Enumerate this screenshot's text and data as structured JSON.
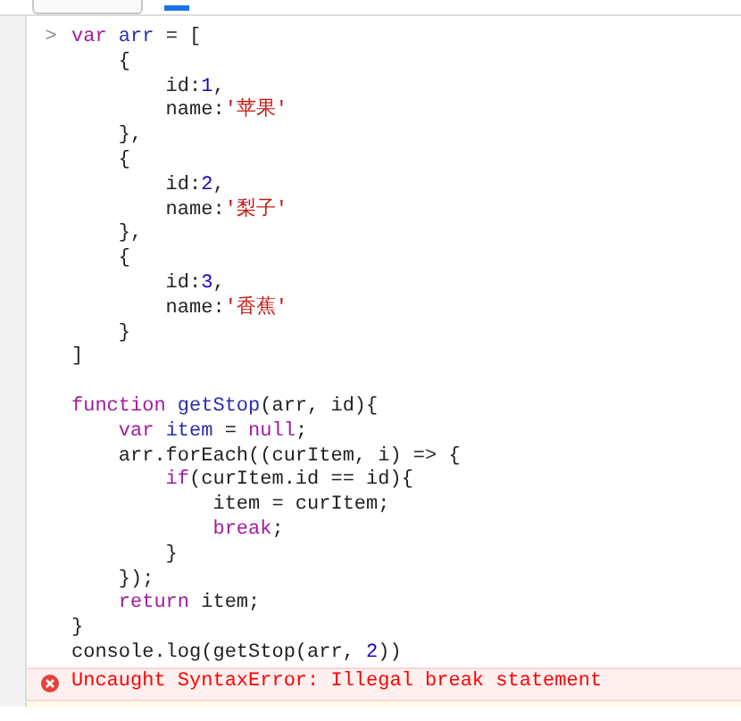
{
  "console": {
    "prompt": ">",
    "blocks": [
      {
        "lines": [
          [
            {
              "text": "var",
              "kind": "keyword"
            },
            {
              "text": " arr",
              "kind": "def"
            },
            {
              "text": " = [",
              "kind": "plain"
            }
          ],
          [
            {
              "text": "    {",
              "kind": "plain"
            }
          ],
          [
            {
              "text": "        id:",
              "kind": "plain"
            },
            {
              "text": "1",
              "kind": "number"
            },
            {
              "text": ",",
              "kind": "plain"
            }
          ],
          [
            {
              "text": "        name:",
              "kind": "plain"
            },
            {
              "text": "'苹果'",
              "kind": "string"
            }
          ],
          [
            {
              "text": "    },",
              "kind": "plain"
            }
          ],
          [
            {
              "text": "    {",
              "kind": "plain"
            }
          ],
          [
            {
              "text": "        id:",
              "kind": "plain"
            },
            {
              "text": "2",
              "kind": "number"
            },
            {
              "text": ",",
              "kind": "plain"
            }
          ],
          [
            {
              "text": "        name:",
              "kind": "plain"
            },
            {
              "text": "'梨子'",
              "kind": "string"
            }
          ],
          [
            {
              "text": "    },",
              "kind": "plain"
            }
          ],
          [
            {
              "text": "    {",
              "kind": "plain"
            }
          ],
          [
            {
              "text": "        id:",
              "kind": "plain"
            },
            {
              "text": "3",
              "kind": "number"
            },
            {
              "text": ",",
              "kind": "plain"
            }
          ],
          [
            {
              "text": "        name:",
              "kind": "plain"
            },
            {
              "text": "'香蕉'",
              "kind": "string"
            }
          ],
          [
            {
              "text": "    }",
              "kind": "plain"
            }
          ],
          [
            {
              "text": "]",
              "kind": "plain"
            }
          ]
        ]
      },
      {
        "lines": [
          [
            {
              "text": "function",
              "kind": "keyword"
            },
            {
              "text": " getStop",
              "kind": "def"
            },
            {
              "text": "(arr, id){",
              "kind": "plain"
            }
          ],
          [
            {
              "text": "    var",
              "kind": "keyword"
            },
            {
              "text": " item",
              "kind": "def"
            },
            {
              "text": " = ",
              "kind": "plain"
            },
            {
              "text": "null",
              "kind": "keyword"
            },
            {
              "text": ";",
              "kind": "plain"
            }
          ],
          [
            {
              "text": "    arr.forEach((curItem, i) => {",
              "kind": "plain"
            }
          ],
          [
            {
              "text": "        if",
              "kind": "keyword"
            },
            {
              "text": "(curItem.id == id){",
              "kind": "plain"
            }
          ],
          [
            {
              "text": "            item = curItem;",
              "kind": "plain"
            }
          ],
          [
            {
              "text": "            break",
              "kind": "keyword"
            },
            {
              "text": ";",
              "kind": "plain"
            }
          ],
          [
            {
              "text": "        }",
              "kind": "plain"
            }
          ],
          [
            {
              "text": "    });",
              "kind": "plain"
            }
          ],
          [
            {
              "text": "    return",
              "kind": "keyword"
            },
            {
              "text": " item;",
              "kind": "plain"
            }
          ],
          [
            {
              "text": "}",
              "kind": "plain"
            }
          ],
          [
            {
              "text": "console.log(getStop(arr, ",
              "kind": "plain"
            },
            {
              "text": "2",
              "kind": "number"
            },
            {
              "text": "))",
              "kind": "plain"
            }
          ]
        ]
      }
    ],
    "error": {
      "message": "Uncaught SyntaxError: Illegal break statement"
    }
  }
}
